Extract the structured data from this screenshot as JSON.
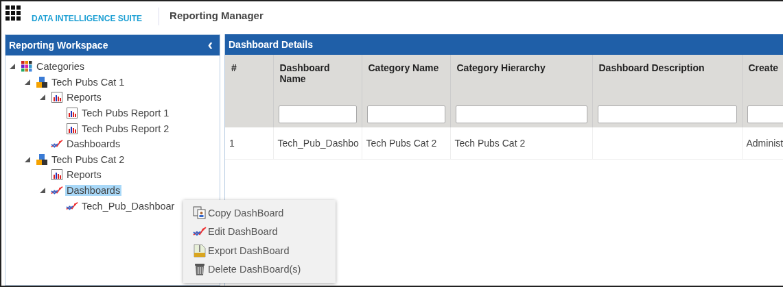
{
  "app": {
    "suite_name": "DATA INTELLIGENCE SUITE",
    "module": "Reporting Manager"
  },
  "workspace": {
    "title": "Reporting Workspace",
    "collapse": "‹",
    "tree": [
      {
        "label": "Categories",
        "kind": "categories",
        "expanded": true,
        "selected": false,
        "children": [
          {
            "label": "Tech Pubs Cat 1",
            "kind": "category",
            "expanded": true,
            "selected": false,
            "children": [
              {
                "label": "Reports",
                "kind": "reports",
                "expanded": true,
                "selected": false,
                "children": [
                  {
                    "label": "Tech Pubs Report 1",
                    "kind": "report",
                    "selected": false
                  },
                  {
                    "label": "Tech Pubs Report 2",
                    "kind": "report",
                    "selected": false
                  }
                ]
              },
              {
                "label": "Dashboards",
                "kind": "dashboards",
                "selected": false
              }
            ]
          },
          {
            "label": "Tech Pubs Cat 2",
            "kind": "category",
            "expanded": true,
            "selected": false,
            "children": [
              {
                "label": "Reports",
                "kind": "reports",
                "selected": false
              },
              {
                "label": "Dashboards",
                "kind": "dashboards",
                "expanded": true,
                "selected": true,
                "children": [
                  {
                    "label": "Tech_Pub_Dashboar",
                    "kind": "dashboard",
                    "selected": false
                  }
                ]
              }
            ]
          }
        ]
      }
    ]
  },
  "details": {
    "title": "Dashboard Details",
    "columns": [
      "#",
      "Dashboard Name",
      "Category Name",
      "Category Hierarchy",
      "Dashboard Description",
      "Create"
    ],
    "rows": [
      [
        "1",
        "Tech_Pub_Dashbo",
        "Tech Pubs Cat 2",
        "Tech Pubs Cat 2",
        "",
        "Administ"
      ]
    ]
  },
  "context_menu": [
    {
      "label": "Copy DashBoard",
      "kind": "copy"
    },
    {
      "label": "Edit DashBoard",
      "kind": "edit"
    },
    {
      "label": "Export DashBoard",
      "kind": "export"
    },
    {
      "label": "Delete DashBoard(s)",
      "kind": "delete"
    }
  ]
}
